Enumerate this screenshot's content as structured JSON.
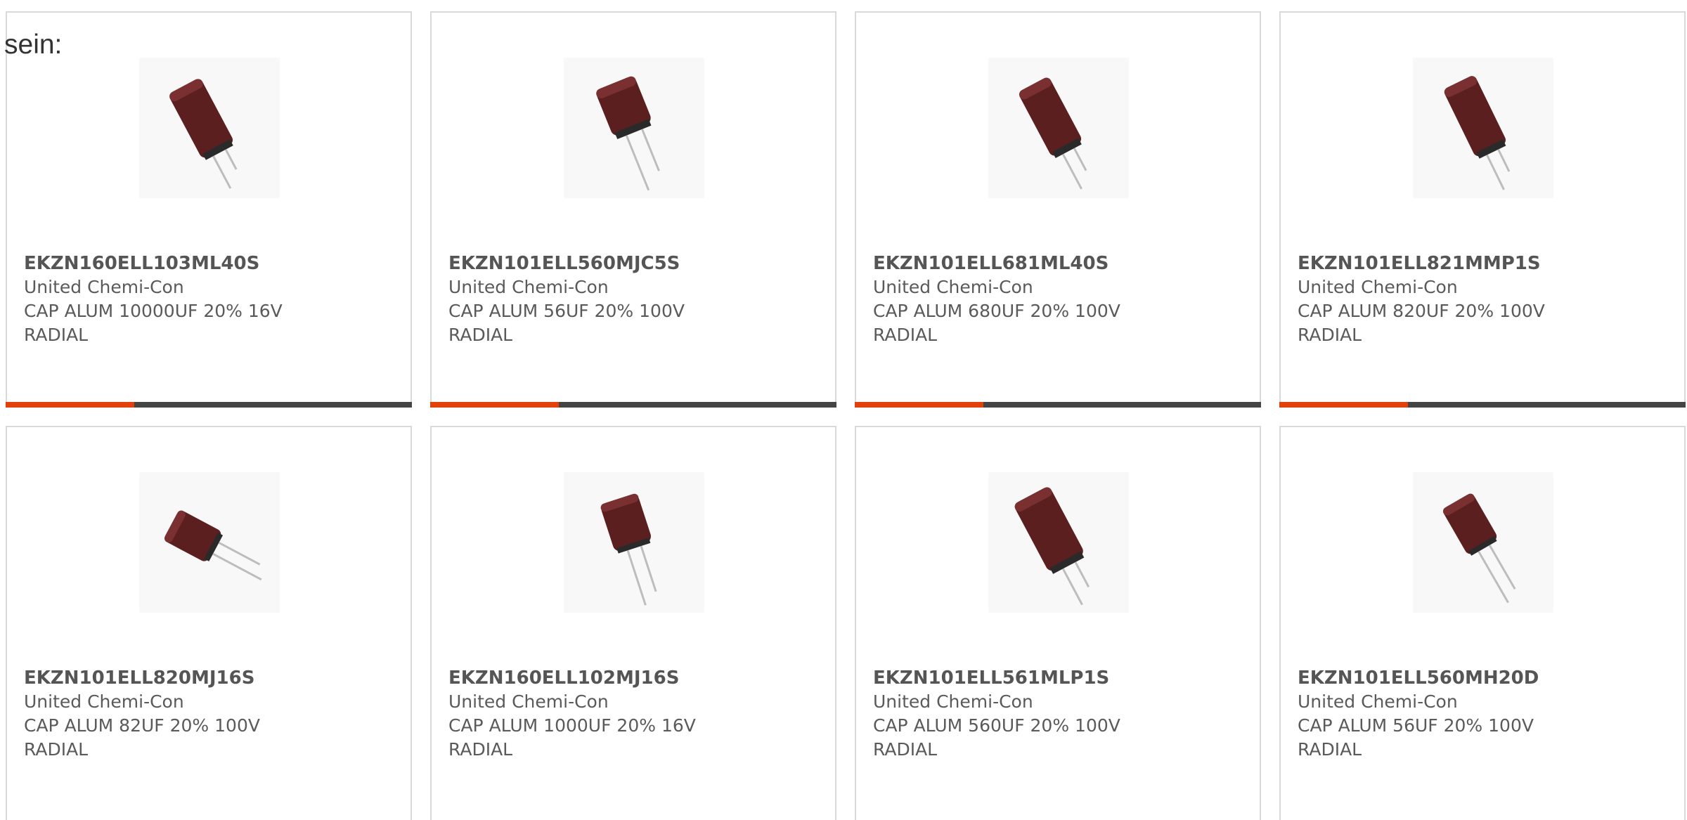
{
  "intro_text": "sein:",
  "colors": {
    "accent": "#e2410c",
    "bar_dark": "#444444",
    "card_border": "#d9d9d9",
    "capacitor_body": "#5b1f1f",
    "lead": "#bdbdbd"
  },
  "products": [
    {
      "part": "EKZN160ELL103ML40S",
      "manufacturer": "United Chemi-Con",
      "description_line1": "CAP ALUM 10000UF 20% 16V",
      "description_line2": "RADIAL",
      "image_icon": "capacitor-icon"
    },
    {
      "part": "EKZN101ELL560MJC5S",
      "manufacturer": "United Chemi-Con",
      "description_line1": "CAP ALUM 56UF 20% 100V",
      "description_line2": "RADIAL",
      "image_icon": "capacitor-icon"
    },
    {
      "part": "EKZN101ELL681ML40S",
      "manufacturer": "United Chemi-Con",
      "description_line1": "CAP ALUM 680UF 20% 100V",
      "description_line2": "RADIAL",
      "image_icon": "capacitor-icon"
    },
    {
      "part": "EKZN101ELL821MMP1S",
      "manufacturer": "United Chemi-Con",
      "description_line1": "CAP ALUM 820UF 20% 100V",
      "description_line2": "RADIAL",
      "image_icon": "capacitor-icon"
    },
    {
      "part": "EKZN101ELL820MJ16S",
      "manufacturer": "United Chemi-Con",
      "description_line1": "CAP ALUM 82UF 20% 100V",
      "description_line2": "RADIAL",
      "image_icon": "capacitor-icon"
    },
    {
      "part": "EKZN160ELL102MJ16S",
      "manufacturer": "United Chemi-Con",
      "description_line1": "CAP ALUM 1000UF 20% 16V",
      "description_line2": "RADIAL",
      "image_icon": "capacitor-icon"
    },
    {
      "part": "EKZN101ELL561MLP1S",
      "manufacturer": "United Chemi-Con",
      "description_line1": "CAP ALUM 560UF 20% 100V",
      "description_line2": "RADIAL",
      "image_icon": "capacitor-icon"
    },
    {
      "part": "EKZN101ELL560MH20D",
      "manufacturer": "United Chemi-Con",
      "description_line1": "CAP ALUM 56UF 20% 100V",
      "description_line2": "RADIAL",
      "image_icon": "capacitor-icon"
    }
  ]
}
